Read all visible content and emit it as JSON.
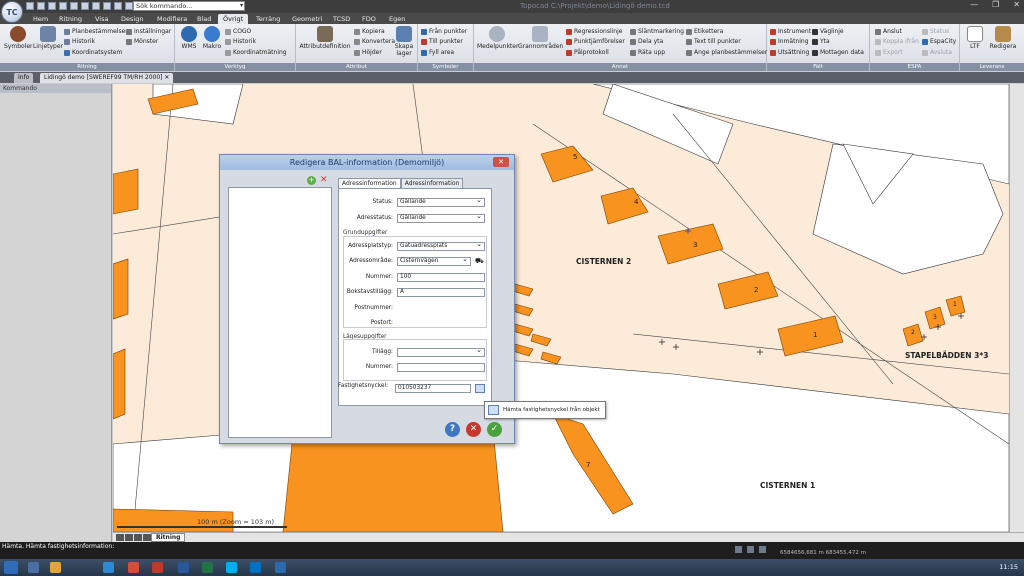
{
  "titlebar": {
    "app_logo": "TC",
    "search_placeholder": "Sök kommando...",
    "window_title": "Topocad   C:\\Projekt\\demo\\Lidingö demo.tcd"
  },
  "ribbon_tabs": [
    "Hem",
    "Ritning",
    "Visa",
    "Design",
    "Modifiera",
    "Blad",
    "Övrigt",
    "Terräng",
    "Geometri",
    "TCSD",
    "FDO",
    "Egen"
  ],
  "ribbon": {
    "ritning": {
      "label": "Ritning",
      "symboler": "Symboler",
      "linjetyper": "Linjetyper",
      "planbestammelser": "Planbestämmelser",
      "historik": "Historik",
      "koordinatsystem": "Koordinatsystem",
      "installningar": "Inställningar",
      "monster": "Mönster"
    },
    "verktyg": {
      "label": "Verktyg",
      "wms": "WMS",
      "makro": "Makro",
      "cogo": "COGO",
      "historik": "Historik",
      "koordinatmatning": "Koordinatmätning"
    },
    "attribut": {
      "label": "Attribut",
      "attributdefinition": "Attributdefinition",
      "kopiera": "Kopiera",
      "konvertera": "Konvertera",
      "hojder": "Höjder",
      "skapa_lager": "Skapa lager"
    },
    "symboler": {
      "label": "Symboler",
      "fran_punkter": "Från punkter",
      "till_punkter": "Till punkter",
      "fyll_area": "Fyll area"
    },
    "annat": {
      "label": "Annat",
      "medelpunkter": "Medelpunkter",
      "grannomraden": "Grannområden",
      "regressionslinje": "Regressionslinje",
      "punktjamforelser": "Punktjämförelser",
      "palprotokoll": "Pålprotokoll",
      "slantmarkering": "Släntmarkering",
      "dela_yta": "Dela yta",
      "rata_upp": "Räta upp",
      "etikettera": "Etikettera",
      "text_till_punkter": "Text till punkter",
      "ange_planbestammelser": "Ange planbestämmelser"
    },
    "falt": {
      "label": "Fält",
      "instrument": "Instrument",
      "inmatning": "Inmätning",
      "utsattning": "Utsättning",
      "vaglinje": "Väglinje",
      "yta": "Yta",
      "mottagen_data": "Mottagen data"
    },
    "espa": {
      "label": "ESPA",
      "anslut": "Anslut",
      "koppla_fran": "Koppla ifrån",
      "export": "Export",
      "status": "Status",
      "espacity": "EspaCity",
      "avsluta": "Avsluta"
    },
    "leverans": {
      "label": "Leverans",
      "ltf": "LTF",
      "redigera": "Redigera"
    }
  },
  "doc_tabs": {
    "info": "Info",
    "active": "Lidingö demo [SWEREF99 TM/RH 2000]"
  },
  "left_panel": {
    "header": "Kommando"
  },
  "map": {
    "labels": {
      "cisternen2": "CISTERNEN 2",
      "cisternen1": "CISTERNEN 1",
      "stapelbadden": "STAPELBÄDDEN 3*3"
    },
    "building_numbers": [
      "5",
      "4",
      "3",
      "2",
      "1",
      "2",
      "3",
      "1",
      "7"
    ],
    "scale": "100 m (Zoom = 103 m)",
    "layout_tab": "Ritning"
  },
  "dialog": {
    "title": "Redigera BAL-information (Demomiljö)",
    "tabs": [
      "Adressinformation",
      "Adressinformation"
    ],
    "fields": {
      "status_label": "Status:",
      "status_value": "Gällande",
      "adressstatus_label": "Adresstatus:",
      "adressstatus_value": "Gällande",
      "grunduppgifter": "Grunduppgifter",
      "adressplatstyp_label": "Adressplatstyp:",
      "adressplatstyp_value": "Gatuadressplats",
      "adressomrade_label": "Adressområde:",
      "adressomrade_value": "Cisternvägen",
      "nummer_label": "Nummer:",
      "nummer_value": "100",
      "bokstavstillagg_label": "Bokstavstillägg:",
      "bokstavstillagg_value": "A",
      "postnummer_label": "Postnummer:",
      "postort_label": "Postort:",
      "lageuppgifter": "Lägesuppgifter",
      "tillagg_label": "Tillägg:",
      "nummer2_label": "Nummer:",
      "fastighetsnyckel_label": "Fastighetsnyckel:",
      "fastighetsnyckel_value": "010503237"
    },
    "tooltip": "Hämta fastighetsnyckel från objekt"
  },
  "statusbar": {
    "text": "Hämta. Hämta fastighetsinformation:",
    "coords": "6584656,681 m  683455,472 m"
  },
  "taskbar": {
    "clock": "11:15"
  },
  "colors": {
    "building": "#f7931e",
    "building_stroke": "#7a3f00",
    "map_bg": "#fcebd9",
    "road_white": "#ffffff"
  }
}
